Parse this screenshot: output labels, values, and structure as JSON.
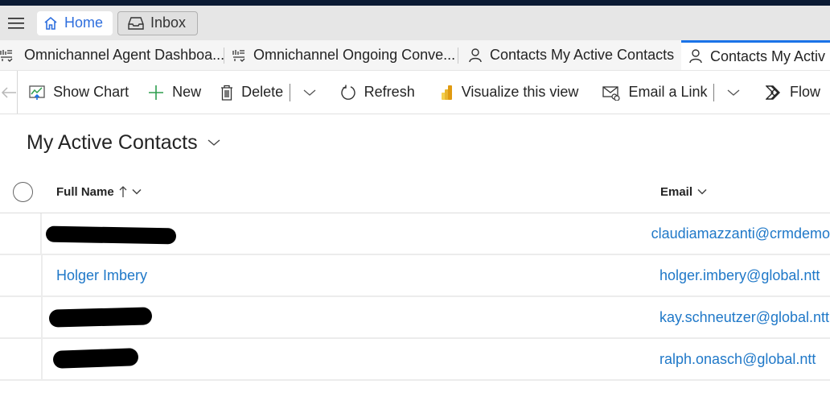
{
  "nav": {
    "home_label": "Home",
    "inbox_label": "Inbox"
  },
  "tabs": [
    {
      "label": "Omnichannel Agent Dashboa...",
      "icon": "dashboard-icon",
      "active": false
    },
    {
      "label": "Omnichannel Ongoing Conve...",
      "icon": "dashboard-icon",
      "active": false
    },
    {
      "label": "Contacts My Active Contacts",
      "icon": "person-icon",
      "active": false
    },
    {
      "label": "Contacts My Activ",
      "icon": "person-icon",
      "active": true
    }
  ],
  "commands": {
    "show_chart": "Show Chart",
    "new": "New",
    "delete": "Delete",
    "refresh": "Refresh",
    "visualize": "Visualize this view",
    "email_link": "Email a Link",
    "flow": "Flow"
  },
  "view": {
    "title": "My Active Contacts"
  },
  "grid": {
    "columns": {
      "name": "Full Name",
      "email": "Email"
    },
    "sort": "ascending",
    "rows": [
      {
        "name": "",
        "name_redacted": true,
        "email": "claudiamazzanti@crmdemo"
      },
      {
        "name": "Holger Imbery",
        "name_redacted": false,
        "email": "holger.imbery@global.ntt"
      },
      {
        "name": "",
        "name_redacted": true,
        "email": "kay.schneutzer@global.ntt"
      },
      {
        "name": "",
        "name_redacted": true,
        "email": "ralph.onasch@global.ntt"
      }
    ]
  },
  "colors": {
    "accent": "#1a73e8",
    "link": "#1f78c8",
    "topbar": "#0b1a33"
  }
}
